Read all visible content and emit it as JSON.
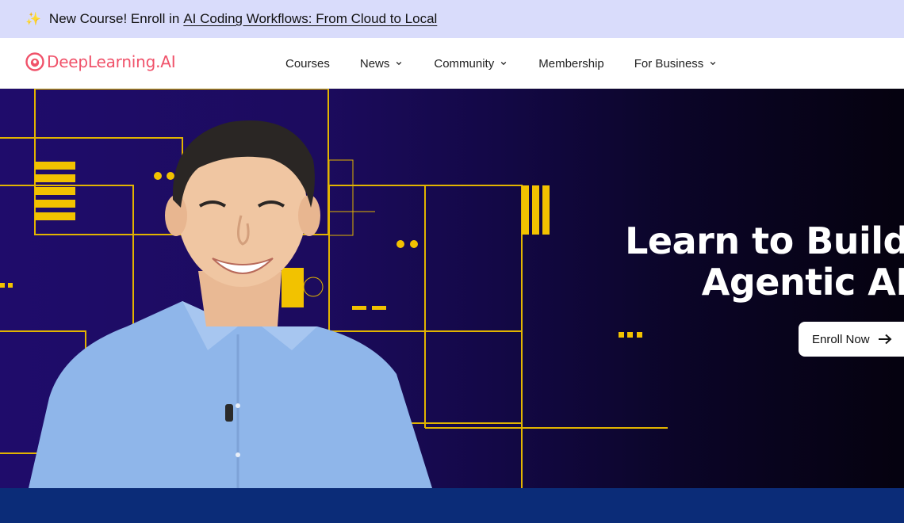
{
  "announcement": {
    "icon": "sparkle-icon",
    "lead": "New Course! Enroll in",
    "link": "AI Coding Workflows: From Cloud to Local"
  },
  "brand": {
    "name": "DeepLearning.AI",
    "color": "#f0526a"
  },
  "nav": {
    "items": [
      {
        "label": "Courses",
        "has_dropdown": false
      },
      {
        "label": "News",
        "has_dropdown": true
      },
      {
        "label": "Community",
        "has_dropdown": true
      },
      {
        "label": "Membership",
        "has_dropdown": false
      },
      {
        "label": "For Business",
        "has_dropdown": true
      }
    ]
  },
  "hero": {
    "title_line1": "Learn to Build",
    "title_line2": "Agentic AI",
    "cta_label": "Enroll Now",
    "accent_color": "#f2c200",
    "background_color": "#1c0b5e"
  }
}
